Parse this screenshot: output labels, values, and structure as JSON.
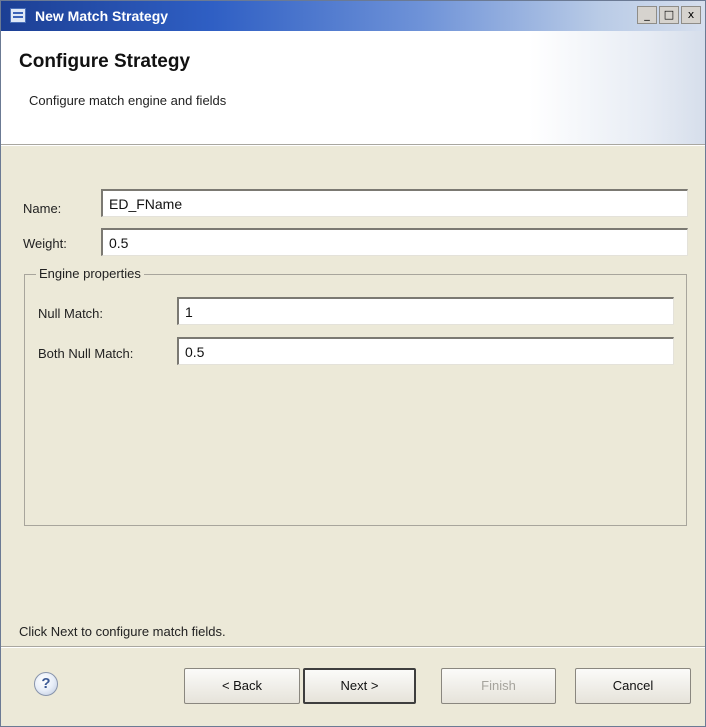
{
  "window": {
    "title": "New Match Strategy",
    "controls": {
      "minimize": "_",
      "maximize": "□",
      "close": "x"
    }
  },
  "header": {
    "title": "Configure Strategy",
    "description": "Configure match engine and fields"
  },
  "form": {
    "name_label": "Name:",
    "name_value": "ED_FName",
    "weight_label": "Weight:",
    "weight_value": "0.5"
  },
  "engine_properties": {
    "legend": "Engine properties",
    "null_match_label": "Null Match:",
    "null_match_value": "1",
    "both_null_match_label": "Both Null Match:",
    "both_null_match_value": "0.5"
  },
  "status": {
    "message": "Click Next to configure match fields."
  },
  "buttons": {
    "help": "?",
    "back": "< Back",
    "next": "Next >",
    "finish": "Finish",
    "cancel": "Cancel"
  }
}
